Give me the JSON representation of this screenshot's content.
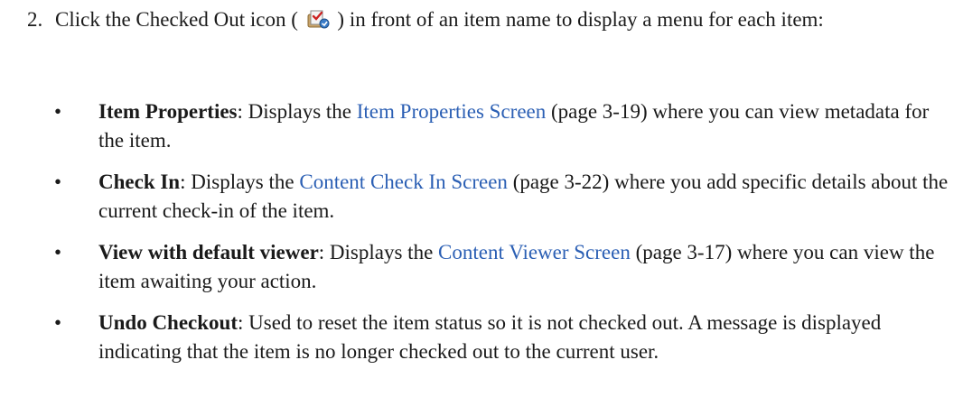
{
  "step": {
    "number": "2.",
    "text_before_icon": "Click the Checked Out icon (",
    "text_after_icon": ") in front of an item name to display a menu for each item:",
    "icon": "checked-out-icon"
  },
  "bullet_char": "•",
  "items": [
    {
      "term": "Item Properties",
      "sep": ": Displays the ",
      "link": "Item Properties Screen",
      "page": " (page 3-19)",
      "rest": " where you can view metadata for the item."
    },
    {
      "term": "Check In",
      "sep": ": Displays the ",
      "link": "Content Check In Screen",
      "page": " (page 3-22)",
      "rest": " where you add specific details about the current check-in of the item."
    },
    {
      "term": "View with default viewer",
      "sep": ": Displays the ",
      "link": "Content Viewer Screen",
      "page": " (page 3-17)",
      "rest": " where you can view the item awaiting your action."
    },
    {
      "term": "Undo Checkout",
      "text": ": Used to reset the item status so it is not checked out. A message is displayed indicating that the item is no longer checked out to the current user."
    }
  ],
  "colors": {
    "link": "#2b5fb4",
    "text": "#1a1a1a"
  }
}
